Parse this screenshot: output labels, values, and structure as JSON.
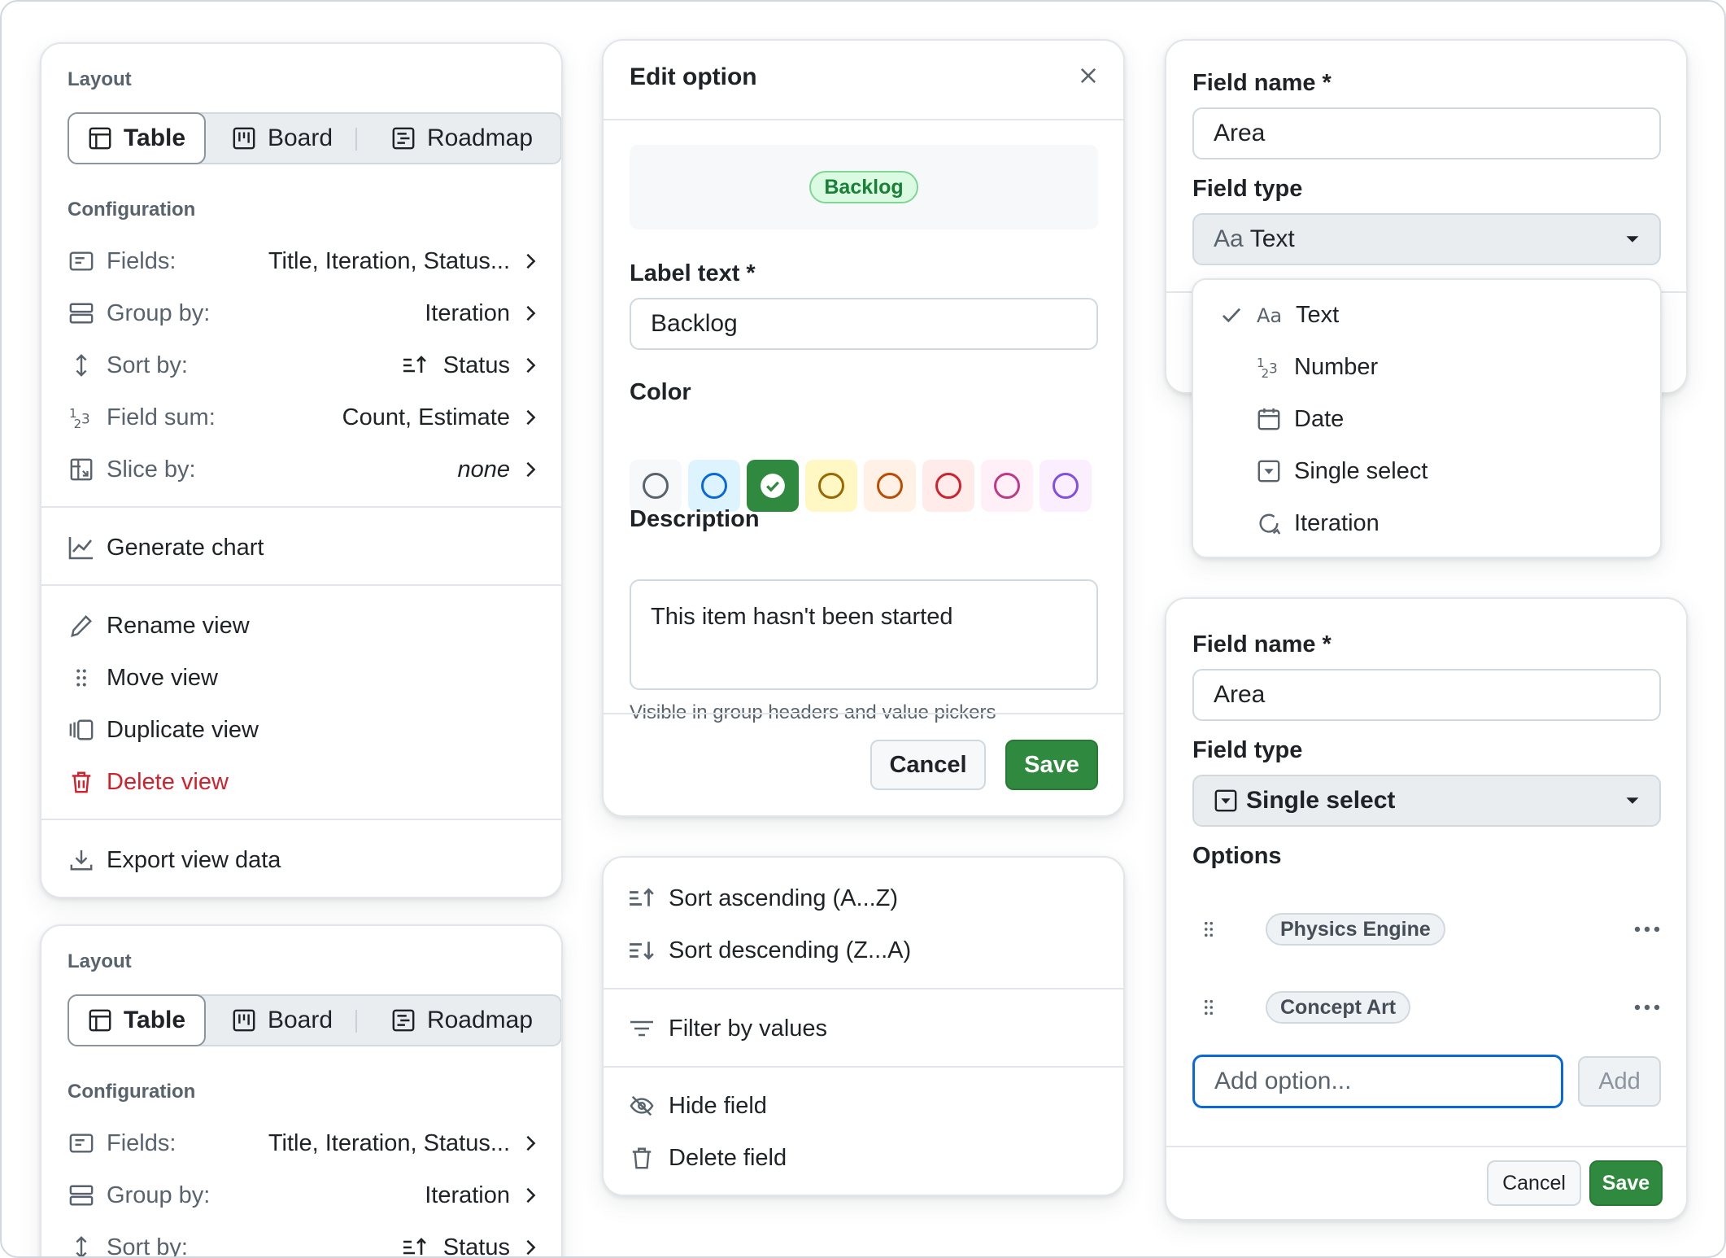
{
  "layout_menu": {
    "section_layout": "Layout",
    "tabs": [
      {
        "label": "Table",
        "icon": "table-icon"
      },
      {
        "label": "Board",
        "icon": "board-icon"
      },
      {
        "label": "Roadmap",
        "icon": "roadmap-icon"
      }
    ],
    "section_configuration": "Configuration",
    "config": [
      {
        "label": "Fields:",
        "value": "Title, Iteration, Status...",
        "icon": "fields-icon"
      },
      {
        "label": "Group by:",
        "value": "Iteration",
        "icon": "group-icon"
      },
      {
        "label": "Sort by:",
        "value": "Status",
        "icon": "sort-icon"
      },
      {
        "label": "Field sum:",
        "value": "Count, Estimate",
        "icon": "number-icon"
      },
      {
        "label": "Slice by:",
        "value": "none",
        "icon": "slice-icon"
      }
    ],
    "generate_chart": "Generate chart",
    "rename_view": "Rename view",
    "move_view": "Move view",
    "duplicate_view": "Duplicate view",
    "delete_view": "Delete view",
    "export_view_data": "Export view data"
  },
  "edit_option": {
    "title": "Edit option",
    "preview_label": "Backlog",
    "label_text_label": "Label text *",
    "label_text_value": "Backlog",
    "color_label": "Color",
    "colors": [
      "#59636e",
      "#0969da",
      "#2f8a3f",
      "#9a6700",
      "#bc4c00",
      "#cf222e",
      "#bf3989",
      "#8250df"
    ],
    "selected_color": "#2f8a3f",
    "description_label": "Description",
    "description_value": "This item hasn't been started",
    "hint": "Visible in group headers and value pickers",
    "cancel": "Cancel",
    "save": "Save"
  },
  "field_menu": {
    "sort_asc": "Sort ascending (A...Z)",
    "sort_desc": "Sort descending (Z...A)",
    "filter": "Filter by values",
    "hide": "Hide field",
    "delete": "Delete field"
  },
  "field_top": {
    "field_name_label": "Field name *",
    "field_name_value": "Area",
    "field_type_label": "Field type",
    "field_type_prefix": "Aa",
    "field_type_value": "Text",
    "dropdown": [
      {
        "label": "Text",
        "icon": "text-icon",
        "selected": true
      },
      {
        "label": "Number",
        "icon": "number-icon"
      },
      {
        "label": "Date",
        "icon": "calendar-icon"
      },
      {
        "label": "Single select",
        "icon": "single-select-icon"
      },
      {
        "label": "Iteration",
        "icon": "iteration-icon"
      }
    ]
  },
  "field_bottom": {
    "field_name_label": "Field name *",
    "field_name_value": "Area",
    "field_type_label": "Field type",
    "field_type_value": "Single select",
    "options_label": "Options",
    "options": [
      "Physics Engine",
      "Concept Art"
    ],
    "add_placeholder": "Add option...",
    "add": "Add",
    "cancel": "Cancel",
    "save": "Save"
  }
}
